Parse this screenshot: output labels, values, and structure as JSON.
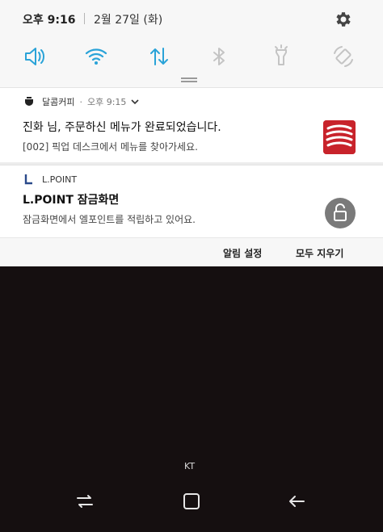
{
  "status_bar": {
    "time": "오후 9:16",
    "date": "2월 27일 (화)"
  },
  "quick_toggles": [
    {
      "icon": "sound-icon",
      "active": true
    },
    {
      "icon": "wifi-icon",
      "active": true
    },
    {
      "icon": "mobile-data-icon",
      "active": true
    },
    {
      "icon": "bluetooth-icon",
      "active": false
    },
    {
      "icon": "flashlight-icon",
      "active": false
    },
    {
      "icon": "auto-rotate-icon",
      "active": false
    }
  ],
  "colors": {
    "active_toggle": "#2aa3d8",
    "inactive_toggle": "#c4c4c4",
    "brand_red": "#c8232b"
  },
  "notifications": [
    {
      "app_name": "달콤커피",
      "time": "오후 9:15",
      "title": "진화 님, 주문하신 메뉴가 완료되었습니다.",
      "body": "[002] 픽업 데스크에서 메뉴를 찾아가세요.",
      "large_icon": "dalkomm-coffee-logo"
    },
    {
      "app_name": "L.POINT",
      "title": "L.POINT 잠금화면",
      "body": "잠금화면에서 엘포인트를 적립하고 있어요.",
      "large_icon": "lock-icon"
    }
  ],
  "actions": {
    "notification_settings": "알림 설정",
    "clear_all": "모두 지우기"
  },
  "lockscreen": {
    "carrier": "KT"
  },
  "navigation": [
    "recents-icon",
    "home-icon",
    "back-icon"
  ]
}
